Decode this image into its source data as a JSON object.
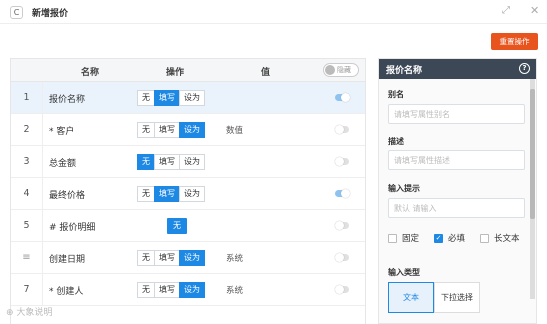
{
  "window": {
    "title": "新增报价",
    "refresh_icon": "C"
  },
  "toolbar": {
    "reset_label": "重置操作"
  },
  "table": {
    "headers": {
      "name": "名称",
      "action": "操作",
      "value": "值"
    },
    "hide_toggle_label": "隐藏",
    "rows": [
      {
        "index": "1",
        "name": "报价名称",
        "mode": "segmented",
        "options": [
          "无",
          "填写",
          "设为"
        ],
        "selected": "填写",
        "value": "",
        "switch_on": true,
        "selected_row": true
      },
      {
        "index": "2",
        "name": "* 客户",
        "mode": "segmented",
        "options": [
          "无",
          "填写",
          "设为"
        ],
        "selected": "设为",
        "value": "数值",
        "switch_on": false,
        "selected_row": false
      },
      {
        "index": "3",
        "name": "总金额",
        "mode": "segmented",
        "options": [
          "无",
          "填写",
          "设为"
        ],
        "selected": "无",
        "value": "",
        "switch_on": false,
        "selected_row": false
      },
      {
        "index": "4",
        "name": "最终价格",
        "mode": "segmented",
        "options": [
          "无",
          "填写",
          "设为"
        ],
        "selected": "填写",
        "value": "",
        "switch_on": true,
        "selected_row": false
      },
      {
        "index": "5",
        "name": "# 报价明细",
        "mode": "single",
        "options": [
          "无"
        ],
        "selected": "无",
        "value": "",
        "switch_on": false,
        "selected_row": false
      },
      {
        "index": "≡",
        "name": "创建日期",
        "mode": "segmented",
        "options": [
          "无",
          "填写",
          "设为"
        ],
        "selected": "设为",
        "value": "系统",
        "switch_on": false,
        "selected_row": false
      },
      {
        "index": "7",
        "name": "* 创建人",
        "mode": "segmented",
        "options": [
          "无",
          "填写",
          "设为"
        ],
        "selected": "设为",
        "value": "系统",
        "switch_on": false,
        "selected_row": false
      }
    ]
  },
  "watermark": "⊕ 大象说明",
  "panel": {
    "title": "报价名称",
    "alias_label": "别名",
    "alias_placeholder": "请填写属性别名",
    "desc_label": "描述",
    "desc_placeholder": "请填写属性描述",
    "hint_label": "输入提示",
    "hint_placeholder": "默认 请输入",
    "checkboxes": [
      {
        "label": "固定",
        "checked": false
      },
      {
        "label": "必填",
        "checked": true
      },
      {
        "label": "长文本",
        "checked": false
      }
    ],
    "input_type_label": "输入类型",
    "input_types": [
      {
        "label": "文本",
        "selected": true
      },
      {
        "label": "下拉选择",
        "selected": false
      }
    ]
  }
}
